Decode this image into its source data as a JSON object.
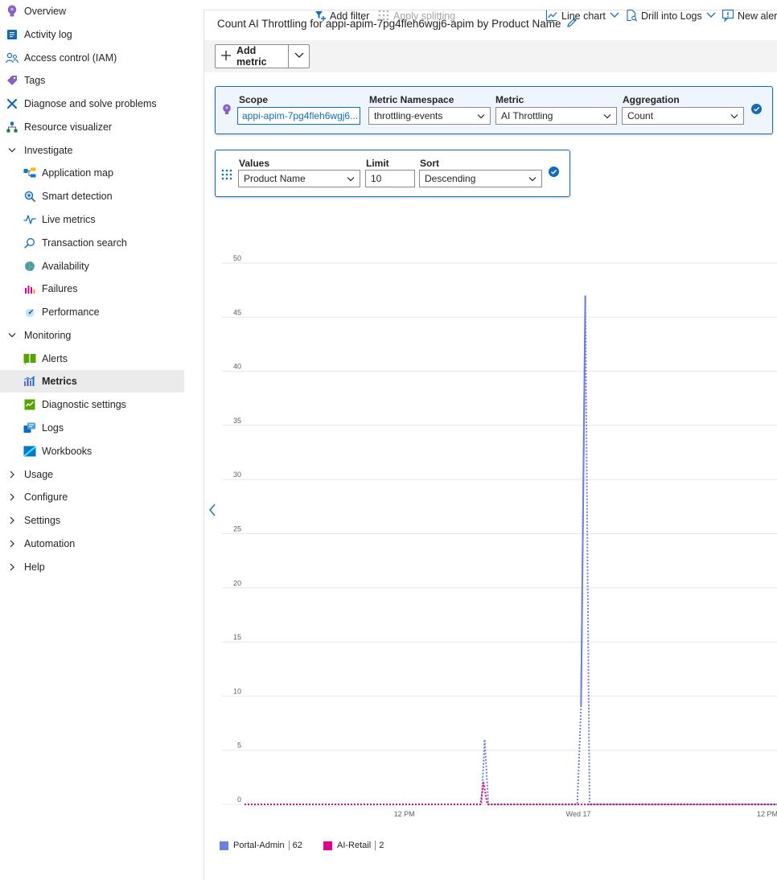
{
  "sidebar": {
    "items": [
      {
        "label": "Overview",
        "icon": "lightbulb-icon",
        "indent": 0,
        "chevron": "",
        "selected": false
      },
      {
        "label": "Activity log",
        "icon": "book-icon",
        "indent": 0,
        "chevron": "",
        "selected": false
      },
      {
        "label": "Access control (IAM)",
        "icon": "people-icon",
        "indent": 0,
        "chevron": "",
        "selected": false
      },
      {
        "label": "Tags",
        "icon": "tag-icon",
        "indent": 0,
        "chevron": "",
        "selected": false
      },
      {
        "label": "Diagnose and solve problems",
        "icon": "wrench-icon",
        "indent": 0,
        "chevron": "",
        "selected": false
      },
      {
        "label": "Resource visualizer",
        "icon": "hierarchy-icon",
        "indent": 0,
        "chevron": "",
        "selected": false
      },
      {
        "label": "Investigate",
        "icon": "",
        "indent": 0,
        "chevron": "down",
        "selected": false
      },
      {
        "label": "Application map",
        "icon": "app-map-icon",
        "indent": 1,
        "chevron": "",
        "selected": false
      },
      {
        "label": "Smart detection",
        "icon": "smart-detection-icon",
        "indent": 1,
        "chevron": "",
        "selected": false
      },
      {
        "label": "Live metrics",
        "icon": "pulse-icon",
        "indent": 1,
        "chevron": "",
        "selected": false
      },
      {
        "label": "Transaction search",
        "icon": "search-icon",
        "indent": 1,
        "chevron": "",
        "selected": false
      },
      {
        "label": "Availability",
        "icon": "globe-icon",
        "indent": 1,
        "chevron": "",
        "selected": false
      },
      {
        "label": "Failures",
        "icon": "failures-icon",
        "indent": 1,
        "chevron": "",
        "selected": false
      },
      {
        "label": "Performance",
        "icon": "performance-icon",
        "indent": 1,
        "chevron": "",
        "selected": false
      },
      {
        "label": "Monitoring",
        "icon": "",
        "indent": 0,
        "chevron": "down",
        "selected": false
      },
      {
        "label": "Alerts",
        "icon": "alerts-icon",
        "indent": 1,
        "chevron": "",
        "selected": false
      },
      {
        "label": "Metrics",
        "icon": "metrics-icon",
        "indent": 1,
        "chevron": "",
        "selected": true
      },
      {
        "label": "Diagnostic settings",
        "icon": "diagnostic-settings-icon",
        "indent": 1,
        "chevron": "",
        "selected": false
      },
      {
        "label": "Logs",
        "icon": "logs-icon",
        "indent": 1,
        "chevron": "",
        "selected": false
      },
      {
        "label": "Workbooks",
        "icon": "workbooks-icon",
        "indent": 1,
        "chevron": "",
        "selected": false
      },
      {
        "label": "Usage",
        "icon": "",
        "indent": 0,
        "chevron": "right",
        "selected": false
      },
      {
        "label": "Configure",
        "icon": "",
        "indent": 0,
        "chevron": "right",
        "selected": false
      },
      {
        "label": "Settings",
        "icon": "",
        "indent": 0,
        "chevron": "right",
        "selected": false
      },
      {
        "label": "Automation",
        "icon": "",
        "indent": 0,
        "chevron": "right",
        "selected": false
      },
      {
        "label": "Help",
        "icon": "",
        "indent": 0,
        "chevron": "right",
        "selected": false
      }
    ]
  },
  "header": {
    "title": "Count AI Throttling for appi-apim-7pg4fleh6wgj6-apim by Product Name"
  },
  "toolbar": {
    "add_metric": "Add metric",
    "add_filter": "Add filter",
    "apply_splitting": "Apply splitting",
    "line_chart": "Line chart",
    "drill_into_logs": "Drill into Logs",
    "new_alert": "New alert"
  },
  "metric_row": {
    "scope_label": "Scope",
    "scope_value": "appi-apim-7pg4fleh6wgj6...",
    "namespace_label": "Metric Namespace",
    "namespace_value": "throttling-events",
    "metric_label": "Metric",
    "metric_value": "AI Throttling",
    "aggregation_label": "Aggregation",
    "aggregation_value": "Count"
  },
  "split_row": {
    "values_label": "Values",
    "values_value": "Product Name",
    "limit_label": "Limit",
    "limit_value": "10",
    "sort_label": "Sort",
    "sort_value": "Descending"
  },
  "colors": {
    "accent": "#0f6cbd",
    "portal_admin": "#6b7fe0",
    "ai_retail": "#e3008c"
  },
  "chart_data": {
    "type": "line",
    "ylim": [
      0,
      50
    ],
    "yticks": [
      "0",
      "5",
      "10",
      "15",
      "20",
      "25",
      "30",
      "35",
      "40",
      "45",
      "50"
    ],
    "xticks": [
      "12 PM",
      "Wed 17",
      "12 PM"
    ],
    "grid": true,
    "legend_position": "bottom-left",
    "series": [
      {
        "name": "Portal-Admin",
        "total": "62",
        "color": "#6b7fe0",
        "points": [
          [
            0,
            0
          ],
          [
            0.445,
            0
          ],
          [
            0.451,
            6
          ],
          [
            0.458,
            0
          ],
          [
            0.625,
            0
          ],
          [
            0.632,
            9
          ],
          [
            0.64,
            47
          ],
          [
            0.648,
            0
          ],
          [
            1,
            0
          ]
        ]
      },
      {
        "name": "AI-Retail",
        "total": "2",
        "color": "#e3008c",
        "points": [
          [
            0,
            0
          ],
          [
            0.443,
            0
          ],
          [
            0.449,
            2
          ],
          [
            0.456,
            0
          ],
          [
            1,
            0
          ]
        ]
      }
    ]
  }
}
